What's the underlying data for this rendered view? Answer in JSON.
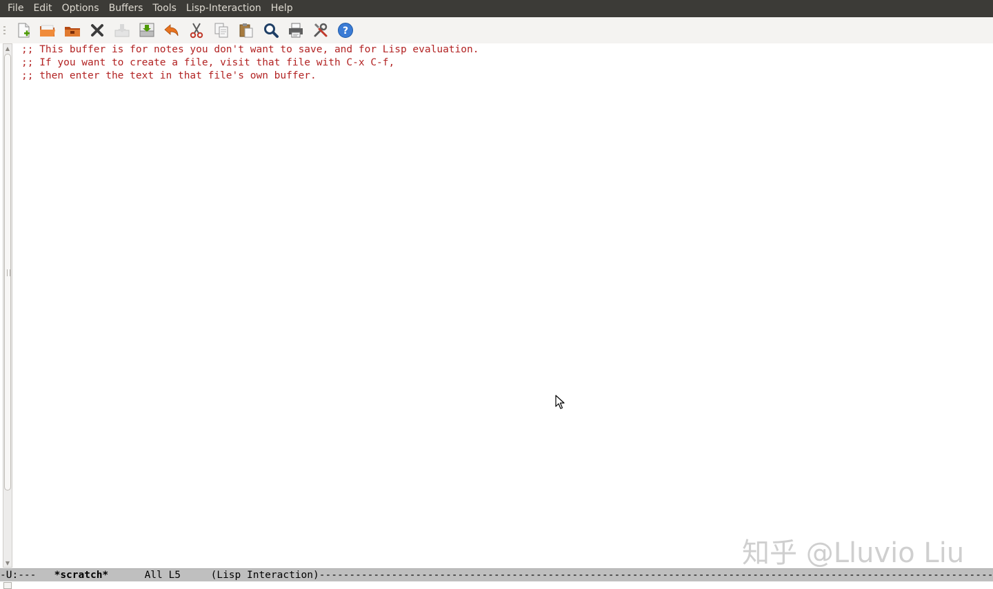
{
  "menubar": {
    "items": [
      "File",
      "Edit",
      "Options",
      "Buffers",
      "Tools",
      "Lisp-Interaction",
      "Help"
    ]
  },
  "toolbar": {
    "buttons": [
      {
        "icon": "new-file-icon"
      },
      {
        "icon": "open-file-icon"
      },
      {
        "icon": "open-directory-icon"
      },
      {
        "icon": "close-buffer-icon"
      },
      {
        "icon": "save-icon"
      },
      {
        "icon": "save-as-icon"
      },
      {
        "icon": "undo-icon"
      },
      {
        "icon": "cut-icon"
      },
      {
        "icon": "copy-icon"
      },
      {
        "icon": "paste-icon"
      },
      {
        "icon": "search-icon"
      },
      {
        "icon": "print-icon"
      },
      {
        "icon": "preferences-icon"
      },
      {
        "icon": "help-icon"
      }
    ]
  },
  "buffer": {
    "lines": [
      ";; This buffer is for notes you don't want to save, and for Lisp evaluation.",
      ";; If you want to create a file, visit that file with C-x C-f,",
      ";; then enter the text in that file's own buffer."
    ],
    "comment_color": "#b22222"
  },
  "modeline": {
    "status": "-U:---",
    "buffer_name": "*scratch*",
    "position": "All L5",
    "mode": "(Lisp Interaction)",
    "fill": "------------------------------------------------------------------------------------------------------------------------"
  },
  "watermark": {
    "text": "知乎 @Lluvio Liu"
  },
  "colors": {
    "menubar_bg": "#3c3b37",
    "menubar_text": "#dfdbd2",
    "toolbar_bg": "#f4f3f1",
    "modeline_bg": "#bfbfbf"
  }
}
